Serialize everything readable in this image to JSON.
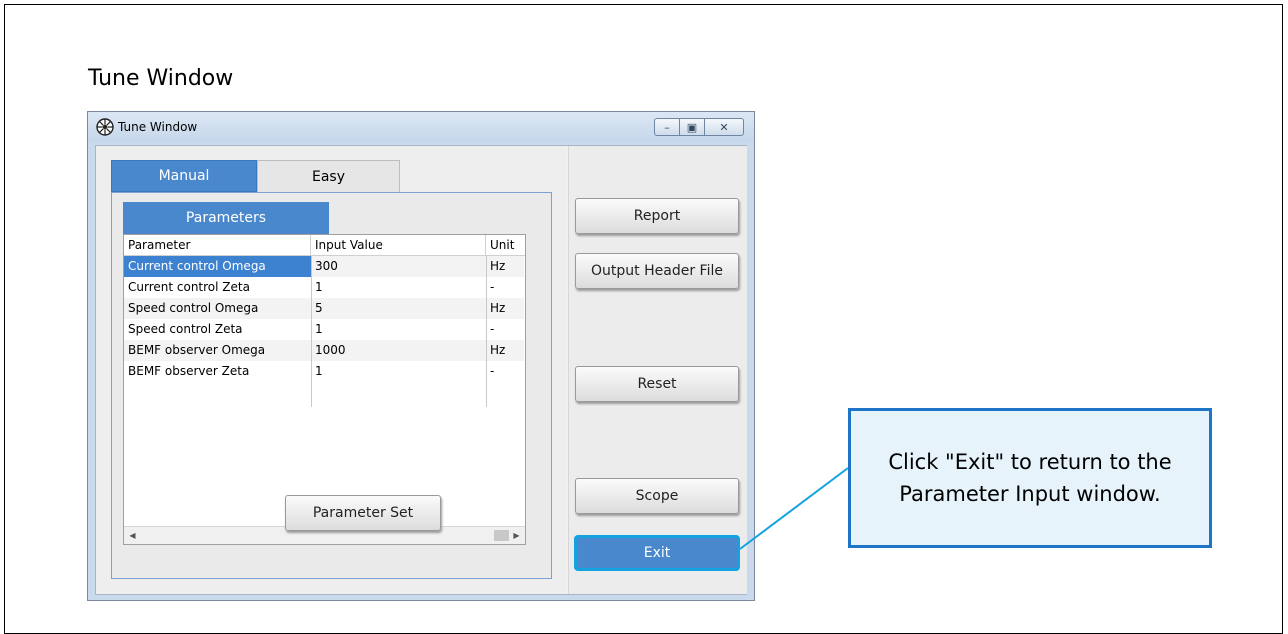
{
  "page": {
    "heading": "Tune Window"
  },
  "window": {
    "title": "Tune Window",
    "controls": [
      "minimize",
      "maximize",
      "close"
    ],
    "tabs": [
      {
        "label": "Manual",
        "active": true
      },
      {
        "label": "Easy",
        "active": false
      }
    ],
    "subtab": "Parameters",
    "grid": {
      "headers": [
        "Parameter",
        "Input Value",
        "Unit"
      ],
      "rows": [
        {
          "parameter": "Current control Omega",
          "value": "300",
          "unit": "Hz",
          "selected": true
        },
        {
          "parameter": "Current control Zeta",
          "value": "1",
          "unit": "-"
        },
        {
          "parameter": "Speed control Omega",
          "value": "5",
          "unit": "Hz"
        },
        {
          "parameter": "Speed control Zeta",
          "value": "1",
          "unit": "-"
        },
        {
          "parameter": "BEMF observer Omega",
          "value": "1000",
          "unit": "Hz"
        },
        {
          "parameter": "BEMF observer Zeta",
          "value": "1",
          "unit": "-"
        }
      ]
    },
    "buttons": {
      "parameter_set": "Parameter Set",
      "report": "Report",
      "output_header_file": "Output Header File",
      "reset": "Reset",
      "scope": "Scope",
      "exit": "Exit"
    }
  },
  "callout": {
    "line1": "Click \"Exit\" to return to the",
    "line2": "Parameter Input window."
  },
  "colors": {
    "accent": "#4a88ce",
    "callout_border": "#1e75c8",
    "highlight_border": "#14a3e0"
  }
}
